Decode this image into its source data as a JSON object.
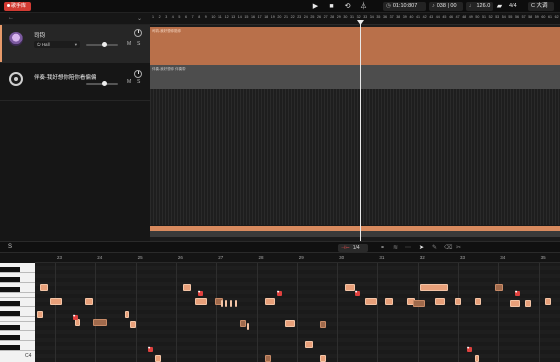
{
  "toolbar": {
    "record_label": "歌手库",
    "time": "01:10:807",
    "beat": "038 | 00",
    "tempo": "126.0",
    "signature": "4/4",
    "key": "C 大调",
    "icons": [
      "play-icon",
      "stop-icon",
      "loop-icon",
      "metronome-icon",
      "clock-icon",
      "note-icon",
      "tempo-icon",
      "speaker-icon"
    ]
  },
  "tracks": [
    {
      "name": "司钧",
      "voice": "Hall",
      "type": "vocal"
    },
    {
      "name": "伴奏-我好想你陪你看偏偏",
      "type": "accompaniment"
    }
  ],
  "arrangement": {
    "vocal_clip_label": "司钧-我好想你陪你",
    "acc_clip_label": "伴奏-我好想你 伴奏带"
  },
  "ruler_numbers": [
    "1",
    "2",
    "3",
    "4",
    "5",
    "6",
    "7",
    "8",
    "9",
    "10",
    "11",
    "12",
    "13",
    "14",
    "15",
    "16",
    "17",
    "18",
    "19",
    "20",
    "21",
    "22",
    "23",
    "24",
    "25",
    "26",
    "27",
    "28",
    "29",
    "30",
    "31",
    "32",
    "33",
    "34",
    "35",
    "36",
    "37",
    "38",
    "39",
    "40",
    "41",
    "42",
    "43",
    "44",
    "45",
    "46",
    "47",
    "48",
    "49",
    "50",
    "51",
    "52",
    "53",
    "54",
    "55",
    "56",
    "57",
    "58",
    "59",
    "60",
    "61",
    "62"
  ],
  "roll": {
    "track_label": "S",
    "quantize": "1/4",
    "bars": [
      "23",
      "24",
      "25",
      "26",
      "27",
      "28",
      "29",
      "30",
      "31",
      "32",
      "33",
      "34",
      "35"
    ],
    "lowest_label": "C4"
  }
}
